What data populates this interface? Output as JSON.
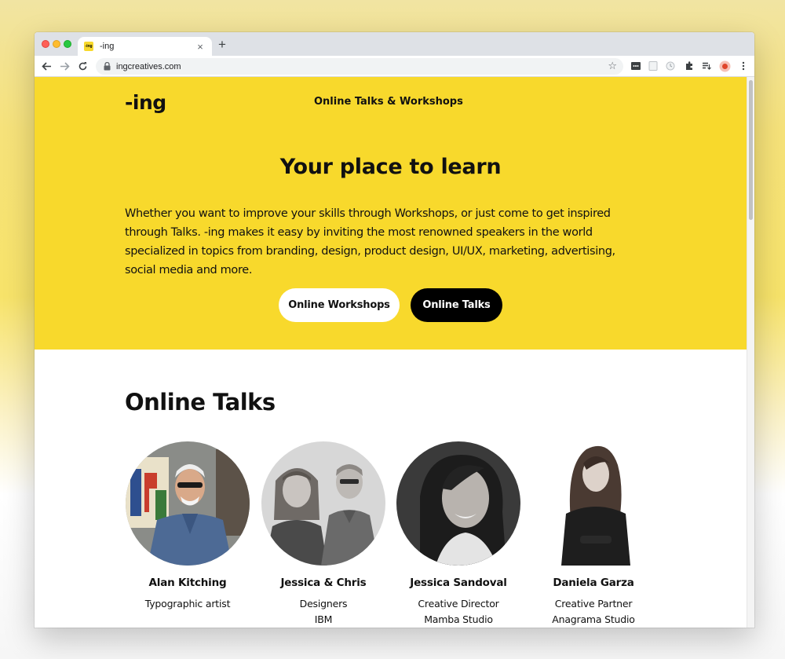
{
  "browser": {
    "tab_favicon": "-ing",
    "tab_title": "-ing",
    "tab_close": "×",
    "new_tab": "+",
    "url": "ingcreatives.com",
    "bookmark_star": "☆"
  },
  "site": {
    "logo": "-ing",
    "nav_link": "Online Talks & Workshops",
    "brand_color": "#f8d92c"
  },
  "hero": {
    "title": "Your place to learn",
    "description": "Whether you want to improve your skills through Workshops, or just come to get inspired through Talks. -ing makes it easy by inviting the most renowned speakers in the world specialized in topics from branding, design, product design, UI/UX, marketing, advertising, social media and more.",
    "buttons": {
      "workshops": "Online Workshops",
      "talks": "Online Talks"
    }
  },
  "talks": {
    "section_title": "Online Talks",
    "speakers": [
      {
        "name": "Alan Kitching",
        "role_line1": "Typographic artist",
        "role_line2": ""
      },
      {
        "name": "Jessica & Chris",
        "role_line1": "Designers",
        "role_line2": "IBM"
      },
      {
        "name": "Jessica Sandoval",
        "role_line1": "Creative Director",
        "role_line2": "Mamba Studio"
      },
      {
        "name": "Daniela Garza",
        "role_line1": "Creative Partner",
        "role_line2": "Anagrama Studio"
      }
    ]
  }
}
